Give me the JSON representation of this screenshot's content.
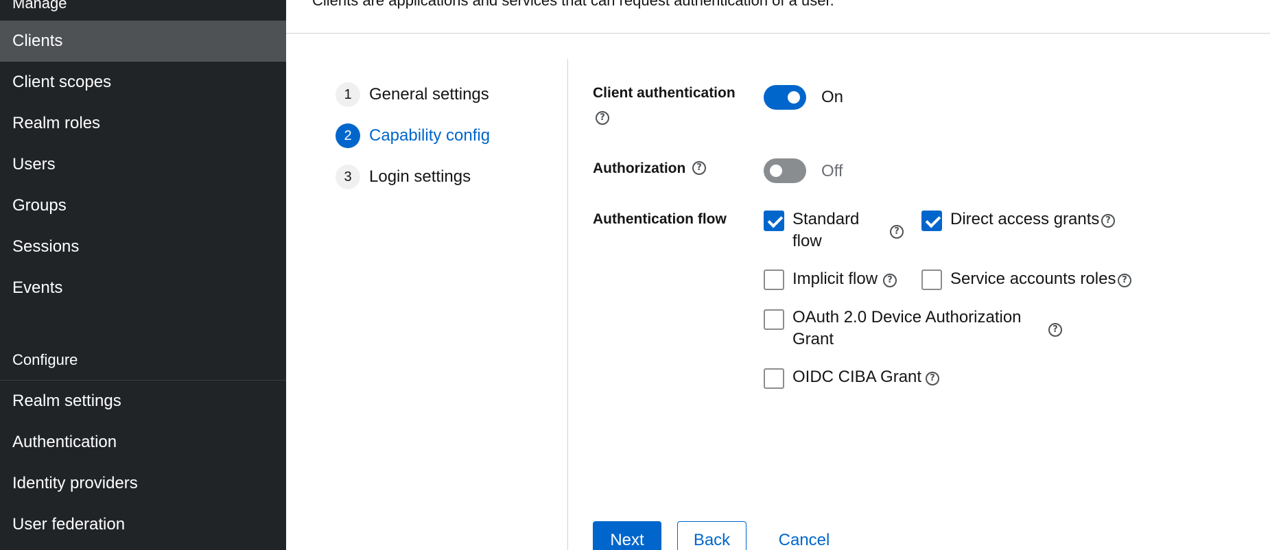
{
  "sidebar": {
    "manage_title": "Manage",
    "manage_items": [
      {
        "label": "Clients",
        "active": true
      },
      {
        "label": "Client scopes"
      },
      {
        "label": "Realm roles"
      },
      {
        "label": "Users"
      },
      {
        "label": "Groups"
      },
      {
        "label": "Sessions"
      },
      {
        "label": "Events"
      }
    ],
    "configure_title": "Configure",
    "configure_items": [
      {
        "label": "Realm settings"
      },
      {
        "label": "Authentication"
      },
      {
        "label": "Identity providers"
      },
      {
        "label": "User federation"
      }
    ]
  },
  "header": {
    "subtitle": "Clients are applications and services that can request authentication of a user."
  },
  "wizard": {
    "steps": [
      {
        "number": "1",
        "label": "General settings"
      },
      {
        "number": "2",
        "label": "Capability config",
        "current": true
      },
      {
        "number": "3",
        "label": "Login settings"
      }
    ]
  },
  "form": {
    "client_authentication": {
      "label": "Client authentication",
      "state": "On"
    },
    "authorization": {
      "label": "Authorization",
      "state": "Off"
    },
    "authentication_flow": {
      "label": "Authentication flow",
      "options": {
        "standard_flow": {
          "line1": "Standard",
          "line2": "flow",
          "checked": true
        },
        "direct_access_grants": {
          "label": "Direct access grants",
          "checked": true
        },
        "implicit_flow": {
          "label": "Implicit flow",
          "checked": false
        },
        "service_accounts_roles": {
          "label": "Service accounts roles",
          "checked": false
        },
        "oauth_device": {
          "line1": "OAuth 2.0 Device Authorization",
          "line2": "Grant",
          "checked": false
        },
        "oidc_ciba": {
          "label": "OIDC CIBA Grant",
          "checked": false
        }
      }
    }
  },
  "actions": {
    "next": "Next",
    "back": "Back",
    "cancel": "Cancel"
  },
  "icons": {
    "help": "?"
  },
  "colors": {
    "primary": "#0066cc",
    "sidebar_bg": "#212427",
    "sidebar_active": "#4f5255",
    "toggle_off": "#8a8d90"
  }
}
